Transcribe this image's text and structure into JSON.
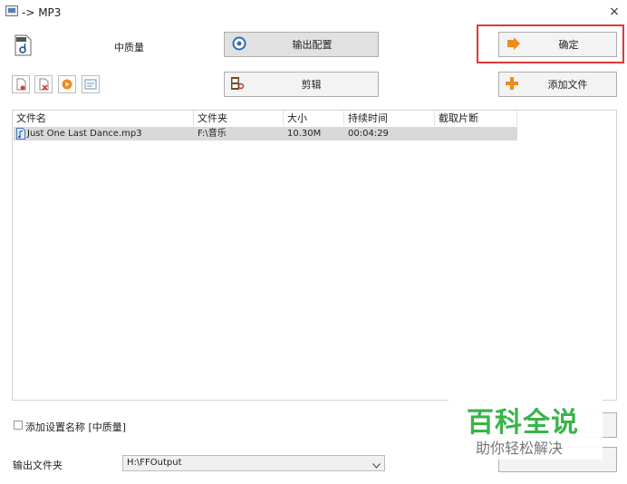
{
  "window": {
    "title": "-> MP3",
    "close_glyph": "×"
  },
  "quality_label": "中质量",
  "buttons": {
    "output_config": "输出配置",
    "confirm": "确定",
    "edit": "剪辑",
    "add_file": "添加文件"
  },
  "table": {
    "columns": [
      "文件名",
      "文件夹",
      "大小",
      "持续时间",
      "截取片断"
    ],
    "rows": [
      {
        "name": "Just One Last Dance.mp3",
        "folder": "F:\\音乐",
        "size": "10.30M",
        "duration": "00:04:29",
        "clip": ""
      }
    ]
  },
  "add_setting_name_label": "添加设置名称 [中质量]",
  "output_folder": {
    "label": "输出文件夹",
    "value": "H:\\FFOutput"
  },
  "watermark": {
    "title": "百科全说",
    "subtitle": "助你轻松解决"
  },
  "colors": {
    "highlight_border": "#e0383b",
    "watermark_green": "#3ab44a",
    "row_selected": "#d9d9d9"
  }
}
